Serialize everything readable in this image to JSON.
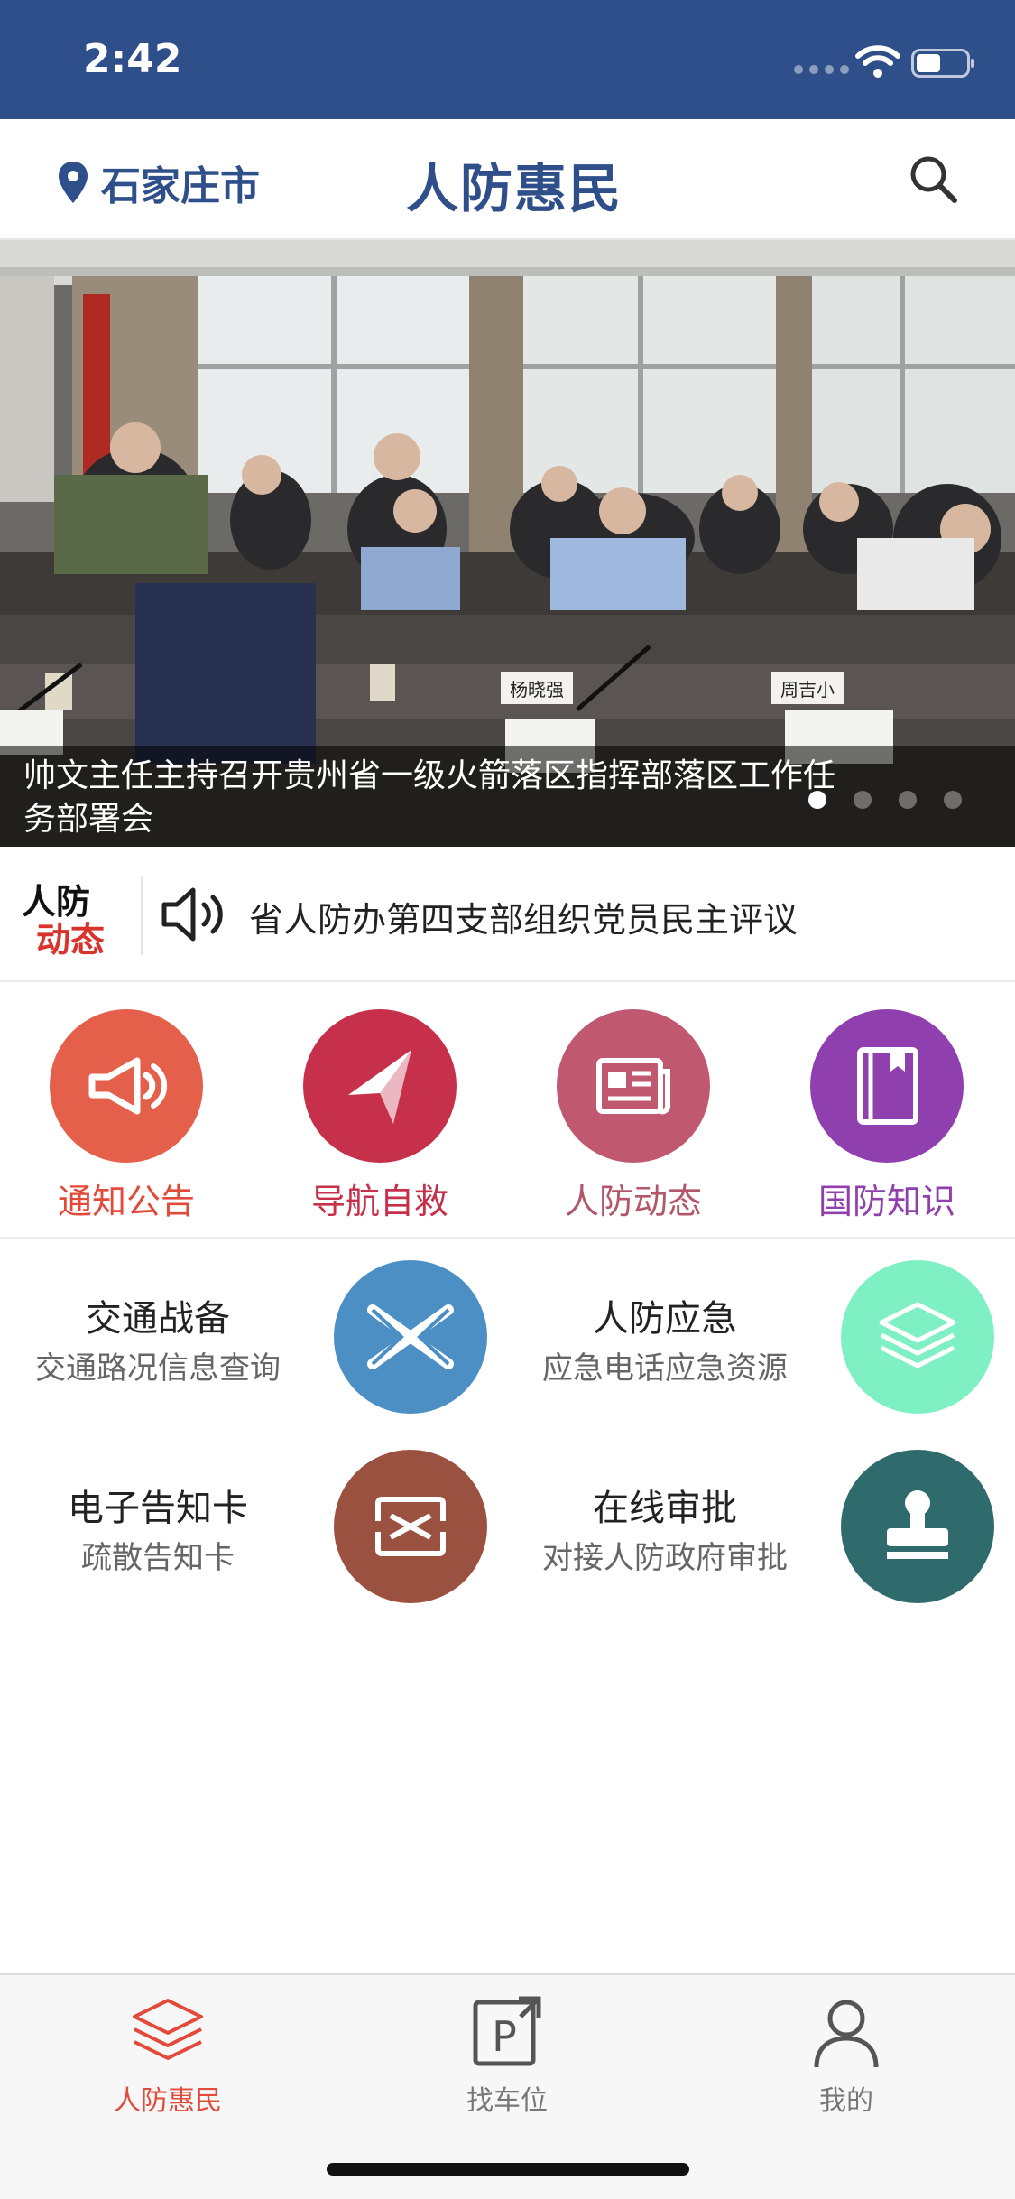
{
  "status_bar": {
    "time": "2:42"
  },
  "header": {
    "location": "石家庄市",
    "title": "人防惠民"
  },
  "banner": {
    "caption": "帅文主任主持召开贵州省一级火箭落区指挥部落区工作任务部署会",
    "name_cards": [
      "杨晓强",
      "周吉小"
    ],
    "dots_count": 4,
    "active_dot": 0
  },
  "news": {
    "logo_line1": "人防",
    "logo_line2": "动态",
    "headline": "省人防办第四支部组织党员民主评议"
  },
  "quick_links": [
    {
      "label": "通知公告",
      "icon": "megaphone-icon",
      "color": "#e4604b",
      "label_color": "#e24a3a"
    },
    {
      "label": "导航自救",
      "icon": "navigation-arrow-icon",
      "color": "#c6304a",
      "label_color": "#c6304a"
    },
    {
      "label": "人防动态",
      "icon": "newspaper-icon",
      "color": "#c0586f",
      "label_color": "#b2576a"
    },
    {
      "label": "国防知识",
      "icon": "book-icon",
      "color": "#8f3fae",
      "label_color": "#8f3fae"
    }
  ],
  "services": [
    {
      "title": "交通战备",
      "subtitle": "交通路况信息查询",
      "icon": "crossroads-icon",
      "color": "#4b8fc4"
    },
    {
      "title": "人防应急",
      "subtitle": "应急电话应急资源",
      "icon": "layers-icon",
      "color": "#7ff0c4"
    },
    {
      "title": "电子告知卡",
      "subtitle": "疏散告知卡",
      "icon": "card-icon",
      "color": "#9b5140"
    },
    {
      "title": "在线审批",
      "subtitle": "对接人防政府审批",
      "icon": "stamp-icon",
      "color": "#2f6b6d"
    }
  ],
  "tabs": [
    {
      "label": "人防惠民",
      "icon": "layers-icon",
      "active": true,
      "color": "#e24a3a"
    },
    {
      "label": "找车位",
      "icon": "parking-icon",
      "active": false,
      "color": "#555555"
    },
    {
      "label": "我的",
      "icon": "user-icon",
      "active": false,
      "color": "#555555"
    }
  ]
}
